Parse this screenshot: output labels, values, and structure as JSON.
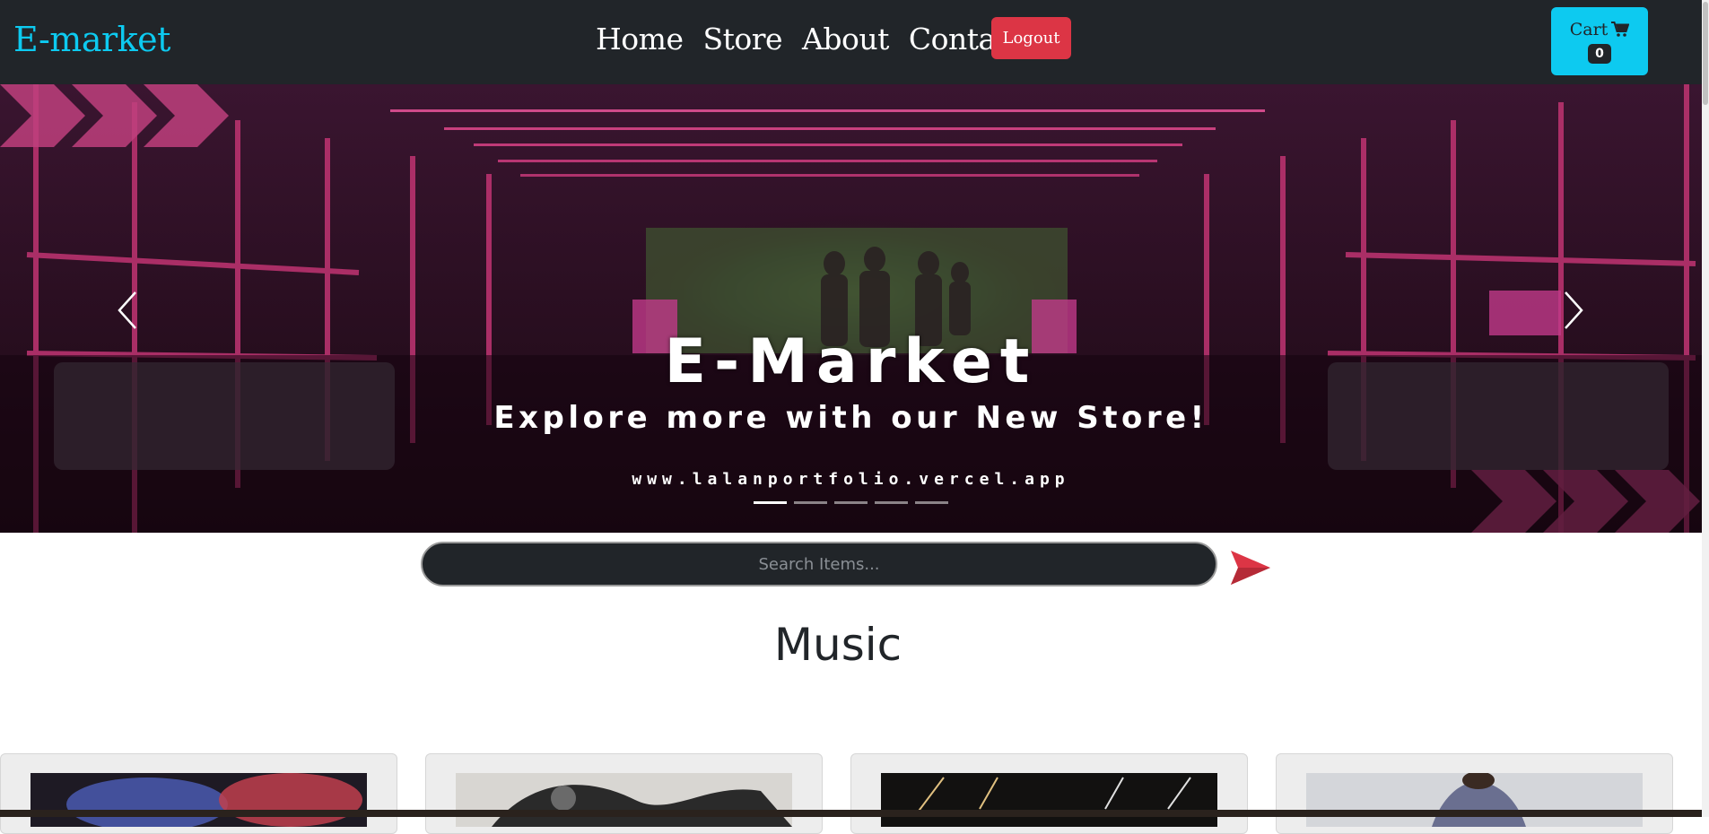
{
  "navbar": {
    "brand": "E-market",
    "links": [
      {
        "label": "Home"
      },
      {
        "label": "Store"
      },
      {
        "label": "About"
      },
      {
        "label": "Contact"
      }
    ],
    "logout_label": "Logout",
    "cart": {
      "label": "Cart",
      "count": "0",
      "icon": "cart-icon"
    }
  },
  "hero": {
    "title": "E-Market",
    "subtitle": "Explore more with our New Store!",
    "url": "www.lalanportfolio.vercel.app",
    "slide_count": 5,
    "active_slide": 1,
    "prev_icon": "chevron-left-icon",
    "next_icon": "chevron-right-icon"
  },
  "search": {
    "placeholder": "Search Items...",
    "value": "",
    "button_icon": "send-icon"
  },
  "section": {
    "title": "Music"
  },
  "colors": {
    "navbar_bg": "#212529",
    "brand": "#0dcaf0",
    "logout_bg": "#dc3545",
    "cart_bg": "#0dcaf0",
    "send_icon": "#dc3545"
  }
}
